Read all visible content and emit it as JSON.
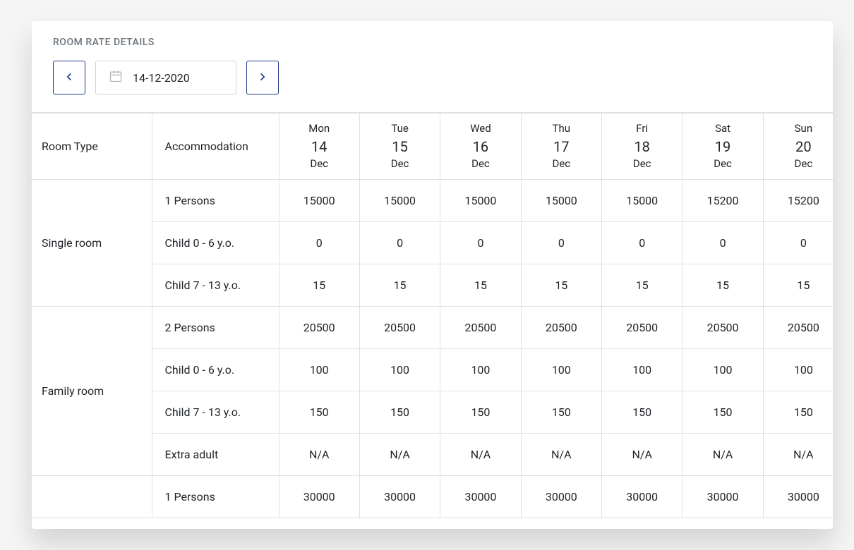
{
  "title": "ROOM RATE DETAILS",
  "date_picker": {
    "value": "14-12-2020"
  },
  "columns": {
    "room_type": "Room Type",
    "accommodation": "Accommodation",
    "days": [
      {
        "dow": "Mon",
        "num": "14",
        "mon": "Dec"
      },
      {
        "dow": "Tue",
        "num": "15",
        "mon": "Dec"
      },
      {
        "dow": "Wed",
        "num": "16",
        "mon": "Dec"
      },
      {
        "dow": "Thu",
        "num": "17",
        "mon": "Dec"
      },
      {
        "dow": "Fri",
        "num": "18",
        "mon": "Dec"
      },
      {
        "dow": "Sat",
        "num": "19",
        "mon": "Dec"
      },
      {
        "dow": "Sun",
        "num": "20",
        "mon": "Dec"
      }
    ]
  },
  "rooms": [
    {
      "name": "Single room",
      "rows": [
        {
          "label": "1 Persons",
          "values": [
            "15000",
            "15000",
            "15000",
            "15000",
            "15000",
            "15200",
            "15200"
          ]
        },
        {
          "label": "Child 0 - 6 y.o.",
          "values": [
            "0",
            "0",
            "0",
            "0",
            "0",
            "0",
            "0"
          ]
        },
        {
          "label": "Child 7 - 13 y.o.",
          "values": [
            "15",
            "15",
            "15",
            "15",
            "15",
            "15",
            "15"
          ]
        }
      ]
    },
    {
      "name": "Family room",
      "rows": [
        {
          "label": "2 Persons",
          "values": [
            "20500",
            "20500",
            "20500",
            "20500",
            "20500",
            "20500",
            "20500"
          ]
        },
        {
          "label": "Child 0 - 6 y.o.",
          "values": [
            "100",
            "100",
            "100",
            "100",
            "100",
            "100",
            "100"
          ]
        },
        {
          "label": "Child 7 - 13 y.o.",
          "values": [
            "150",
            "150",
            "150",
            "150",
            "150",
            "150",
            "150"
          ]
        },
        {
          "label": "Extra adult",
          "values": [
            "N/A",
            "N/A",
            "N/A",
            "N/A",
            "N/A",
            "N/A",
            "N/A"
          ]
        }
      ]
    },
    {
      "name": "",
      "rows": [
        {
          "label": "1 Persons",
          "values": [
            "30000",
            "30000",
            "30000",
            "30000",
            "30000",
            "30000",
            "30000"
          ]
        }
      ]
    }
  ]
}
